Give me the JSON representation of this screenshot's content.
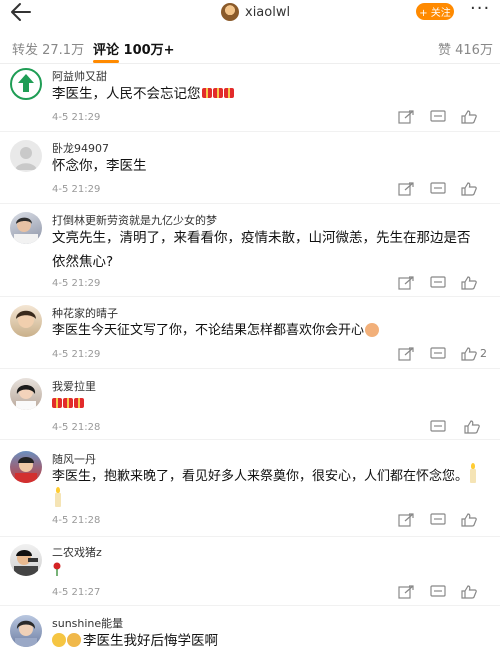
{
  "header": {
    "username": "xiaolwl",
    "follow_label": "+ 关注",
    "more_label": "···"
  },
  "tabs": {
    "repost": "转发 27.1万",
    "comments": "评论 100万+",
    "likes": "赞 416万"
  },
  "comments": [
    {
      "name": "阿益帅又甜",
      "text": "李医生，人民不会忘记您",
      "time": "4-5 21:29",
      "likes": ""
    },
    {
      "name": "卧龙94907",
      "text": "怀念你，李医生",
      "time": "4-5 21:29",
      "likes": ""
    },
    {
      "name": "打倒林更新劳资就是九亿少女的梦",
      "text": "文亮先生，清明了，来看看你，疫情未散，山河微恙，先生在那边是否依然焦心?",
      "time": "4-5 21:29",
      "likes": ""
    },
    {
      "name": "种花家的晴子",
      "text": "李医生今天征文写了你，不论结果怎样都喜欢你会开心",
      "time": "4-5 21:29",
      "likes": "2"
    },
    {
      "name": "我爱拉里",
      "text": "",
      "time": "4-5 21:28",
      "likes": ""
    },
    {
      "name": "随风一丹",
      "text": "李医生，抱歉来晚了，看见好多人来祭奠你，很安心，人们都在怀念您。",
      "time": "4-5 21:28",
      "likes": ""
    },
    {
      "name": "二农戏猪z",
      "text": "",
      "time": "4-5 21:27",
      "likes": ""
    },
    {
      "name": "sunshine能量",
      "text": "李医生我好后悔学医啊",
      "time": "",
      "likes": ""
    }
  ]
}
